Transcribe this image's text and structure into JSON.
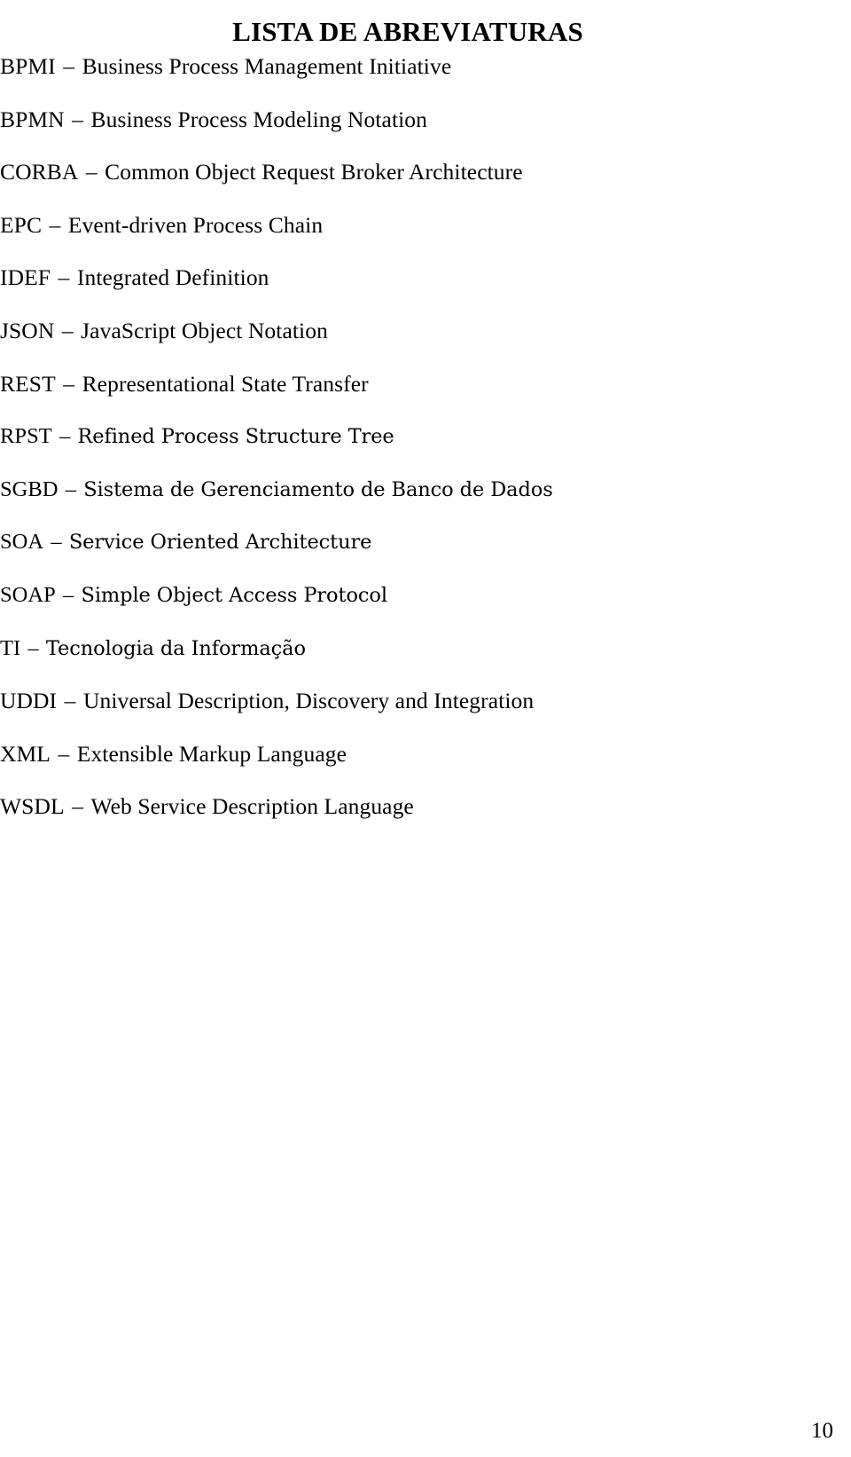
{
  "document": {
    "title": "LISTA DE ABREVIATURAS",
    "page_number": "10",
    "separator": "–"
  },
  "abbreviations": [
    {
      "term": "BPMI",
      "definition": "Business Process Management Initiative"
    },
    {
      "term": "BPMN",
      "definition": "Business Process Modeling Notation"
    },
    {
      "term": "CORBA",
      "definition": "Common Object Request Broker Architecture"
    },
    {
      "term": "EPC",
      "definition": "Event-driven Process Chain"
    },
    {
      "term": "IDEF",
      "definition": "Integrated Definition"
    },
    {
      "term": "JSON",
      "definition": "JavaScript Object Notation"
    },
    {
      "term": "REST",
      "definition": "Representational State Transfer"
    },
    {
      "term": "RPST",
      "definition": "Refined Process Structure Tree"
    },
    {
      "term": "SGBD",
      "definition": "Sistema de Gerenciamento de Banco de Dados"
    },
    {
      "term": "SOA",
      "definition": "Service Oriented Architecture"
    },
    {
      "term": "SOAP",
      "definition": "Simple Object Access Protocol"
    },
    {
      "term": "TI",
      "definition": "Tecnologia da Informação"
    },
    {
      "term": "UDDI",
      "definition": "Universal Description, Discovery and Integration"
    },
    {
      "term": "XML",
      "definition": "Extensible Markup Language"
    },
    {
      "term": "WSDL",
      "definition": "Web Service Description Language"
    }
  ]
}
